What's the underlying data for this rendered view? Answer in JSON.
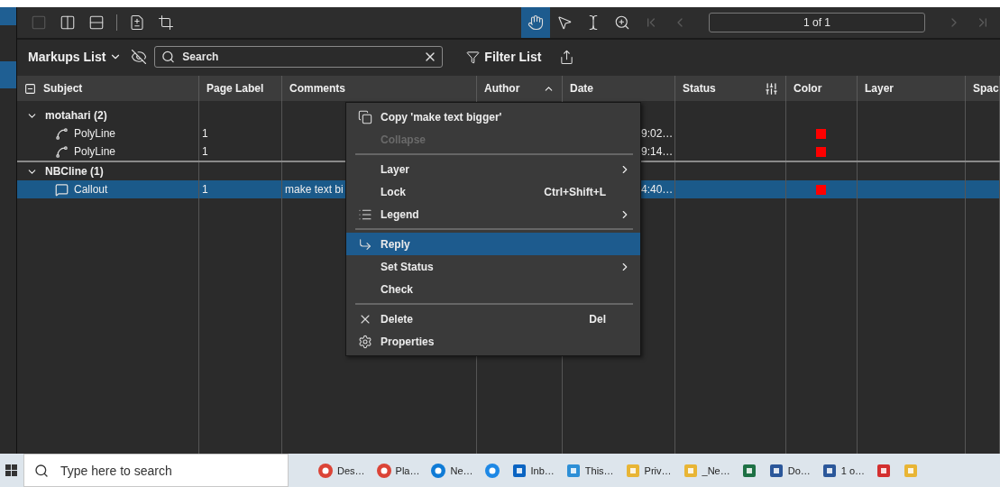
{
  "toolbar": {
    "tools": [
      {
        "selected": true
      },
      {
        "selected": false
      },
      {
        "selected": false
      },
      {
        "selected": false
      }
    ],
    "nav_before": [
      {
        "disabled": true
      },
      {
        "disabled": true
      }
    ],
    "page_field": {
      "value": "1 of 1"
    },
    "nav_after": [
      {
        "disabled": true
      },
      {
        "disabled": true
      }
    ]
  },
  "markups_bar": {
    "title": "Markups List",
    "search": {
      "placeholder": "Search"
    },
    "filter_button": "Filter List"
  },
  "table": {
    "columns": [
      {
        "label": "Subject"
      },
      {
        "label": "Page Label"
      },
      {
        "label": "Comments"
      },
      {
        "label": "Author",
        "sorted": true
      },
      {
        "label": "Date"
      },
      {
        "label": "Status"
      },
      {
        "label": "Color"
      },
      {
        "label": "Layer"
      },
      {
        "label": "Spac"
      }
    ],
    "groups": [
      {
        "label": "motahari (2)",
        "expanded": true,
        "rows": [
          {
            "kind": "polyline",
            "subject": "PolyLine",
            "page_label": "1",
            "date": "9:02…",
            "color": "#ff0000",
            "selected": false
          },
          {
            "kind": "polyline",
            "subject": "PolyLine",
            "page_label": "1",
            "date": "9:14…",
            "color": "#ff0000",
            "selected": false
          }
        ]
      },
      {
        "label": "NBCline (1)",
        "expanded": true,
        "rows": [
          {
            "kind": "callout",
            "subject": "Callout",
            "page_label": "1",
            "comments": "make text bi",
            "date": "4:40…",
            "color": "#ff0000",
            "selected": true
          }
        ]
      }
    ]
  },
  "context_menu": {
    "items": [
      {
        "kind": "item",
        "label": "Copy 'make text bigger'",
        "disabled": false,
        "selected": false,
        "submenu": false
      },
      {
        "kind": "item",
        "label": "Collapse",
        "disabled": true,
        "selected": false,
        "submenu": false
      },
      {
        "kind": "separator"
      },
      {
        "kind": "item",
        "label": "Layer",
        "disabled": false,
        "selected": false,
        "submenu": true
      },
      {
        "kind": "item",
        "label": "Lock",
        "shortcut": "Ctrl+Shift+L",
        "disabled": false,
        "selected": false,
        "submenu": false
      },
      {
        "kind": "item",
        "label": "Legend",
        "disabled": false,
        "selected": false,
        "submenu": true
      },
      {
        "kind": "separator"
      },
      {
        "kind": "item",
        "label": "Reply",
        "disabled": false,
        "selected": true,
        "submenu": false
      },
      {
        "kind": "item",
        "label": "Set Status",
        "disabled": false,
        "selected": false,
        "submenu": true
      },
      {
        "kind": "item",
        "label": "Check",
        "disabled": false,
        "selected": false,
        "submenu": false
      },
      {
        "kind": "separator"
      },
      {
        "kind": "item",
        "label": "Delete",
        "shortcut": "Del",
        "disabled": false,
        "selected": false,
        "submenu": false
      },
      {
        "kind": "item",
        "label": "Properties",
        "disabled": false,
        "selected": false,
        "submenu": false
      }
    ]
  },
  "taskbar": {
    "search": {
      "placeholder": "Type here to search"
    },
    "apps": [
      {
        "kind": "labeled",
        "label": "Des…"
      },
      {
        "kind": "labeled",
        "label": "Pla…"
      },
      {
        "kind": "labeled",
        "label": "Ne…"
      },
      {
        "kind": "icon_only"
      },
      {
        "kind": "labeled",
        "label": "Inb…"
      },
      {
        "kind": "labeled",
        "label": "This…"
      },
      {
        "kind": "labeled",
        "label": "Priv…"
      },
      {
        "kind": "labeled",
        "label": "_Ne…"
      },
      {
        "kind": "icon_only"
      },
      {
        "kind": "labeled",
        "label": "Do…"
      },
      {
        "kind": "labeled",
        "label": "1 o…"
      },
      {
        "kind": "icon_only"
      },
      {
        "kind": "icon_only"
      }
    ]
  }
}
